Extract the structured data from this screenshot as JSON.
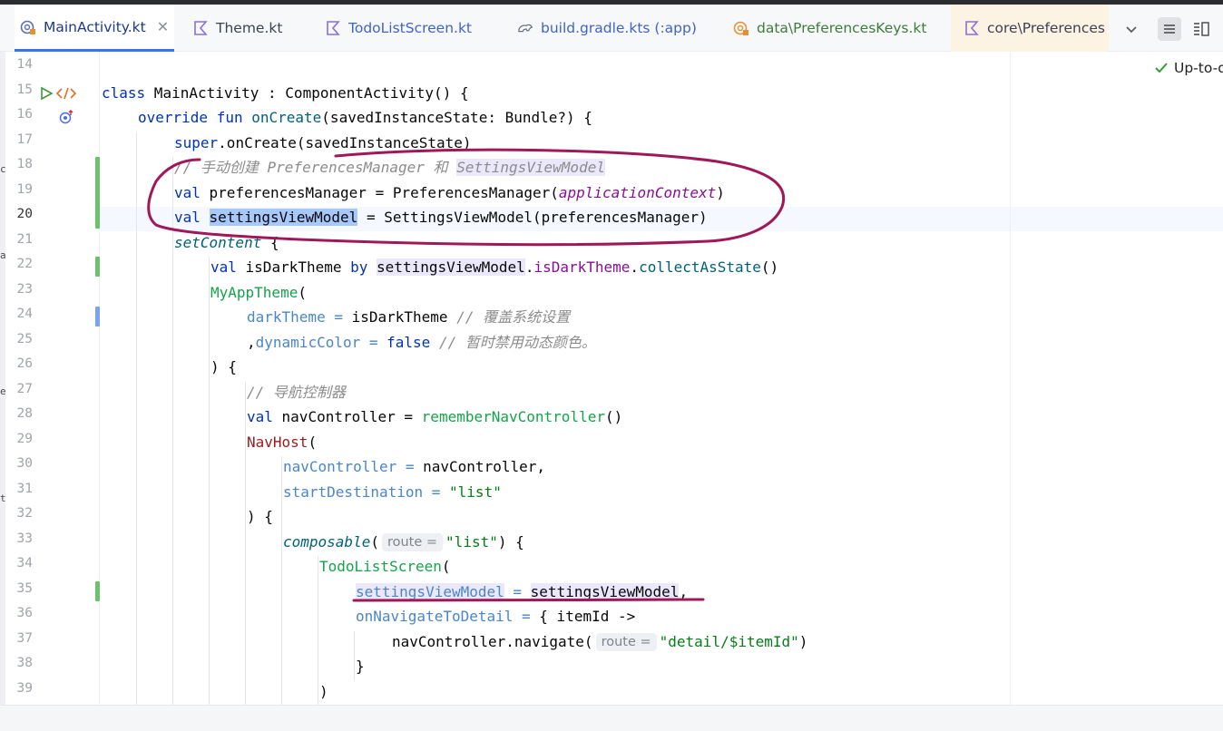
{
  "tabs": [
    {
      "label": "MainActivity.kt",
      "icon": "kotlin-class-icon",
      "active": true
    },
    {
      "label": "Theme.kt",
      "icon": "kotlin-file-icon"
    },
    {
      "label": "TodoListScreen.kt",
      "icon": "kotlin-file-icon"
    },
    {
      "label": "build.gradle.kts (:app)",
      "icon": "gradle-icon"
    },
    {
      "label": "data\\PreferencesKeys.kt",
      "icon": "kotlin-class-icon"
    },
    {
      "label": "core\\Preferences",
      "icon": "kotlin-file-icon"
    }
  ],
  "status": {
    "text": "Up-to-d"
  },
  "left_edge": {
    "c1": "c",
    "c2": "a",
    "c3": "e",
    "c4": "t"
  },
  "lines": {
    "n14": "14",
    "n15": "15",
    "n16": "16",
    "n17": "17",
    "n18": "18",
    "n19": "19",
    "n20": "20",
    "n21": "21",
    "n22": "22",
    "n23": "23",
    "n24": "24",
    "n25": "25",
    "n26": "26",
    "n27": "27",
    "n28": "28",
    "n29": "29",
    "n30": "30",
    "n31": "31",
    "n32": "32",
    "n33": "33",
    "n34": "34",
    "n35": "35",
    "n36": "36",
    "n37": "37",
    "n38": "38",
    "n39": "39"
  },
  "code": {
    "l15": {
      "kw": "class",
      "rest": " MainActivity : ComponentActivity() {"
    },
    "l16": {
      "kw": "override fun",
      "fn": "onCreate",
      "rest": "(savedInstanceState: Bundle?) {"
    },
    "l17": {
      "kw": "super",
      "rest": ".onCreate(savedInstanceState)"
    },
    "l18": {
      "comment": "// 手动创建 PreferencesManager 和 ",
      "comment_hl": "SettingsViewModel"
    },
    "l19": {
      "kw": "val",
      "mid": " preferencesManager = PreferencesManager(",
      "ctx": "applicationContext",
      "end": ")"
    },
    "l20": {
      "kw": "val",
      "sel": "settingsViewModel",
      "rest": " = SettingsViewModel(preferencesManager)"
    },
    "l21": {
      "fn": "setContent",
      "rest": " {"
    },
    "l22": {
      "kw": "val",
      "a": " isDarkTheme ",
      "by": "by",
      "b": " ",
      "vm": "settingsViewModel",
      "dot": ".",
      "prop": "isDarkTheme",
      "dot2": ".",
      "fn": "collectAsState",
      "end": "()"
    },
    "l23": {
      "comp": "MyAppTheme",
      "rest": "("
    },
    "l24": {
      "param": "darkTheme =",
      "val": " isDarkTheme ",
      "comment": "// 覆盖系统设置"
    },
    "l25": {
      "comma": ",",
      "param": "dynamicColor =",
      "sp": " ",
      "kw": "false",
      "sp2": " ",
      "comment": "// 暂时禁用动态颜色。"
    },
    "l26": {
      "rest": ") {"
    },
    "l27": {
      "comment": "// 导航控制器"
    },
    "l28": {
      "kw": "val",
      "mid": " navController = ",
      "fn": "rememberNavController",
      "end": "()"
    },
    "l29": {
      "navhost": "NavHost",
      "rest": "("
    },
    "l30": {
      "param": "navController =",
      "rest": " navController,"
    },
    "l31": {
      "param": "startDestination =",
      "sp": " ",
      "str": "\"list\""
    },
    "l32": {
      "rest": ") {"
    },
    "l33": {
      "fn": "composable",
      "open": "(",
      "hint": "route =",
      "str": "\"list\"",
      "end": ") {"
    },
    "l34": {
      "comp": "TodoListScreen",
      "rest": "("
    },
    "l35": {
      "param": "settingsViewModel",
      "eq": " = ",
      "val": "settingsViewModel",
      "end": ","
    },
    "l36": {
      "param": "onNavigateToDetail =",
      "rest": " { itemId ->"
    },
    "l37": {
      "mid": "navController.navigate(",
      "hint": "route =",
      "str": "\"detail/$itemId\"",
      "end": ")"
    },
    "l38": {
      "rest": "}"
    },
    "l39": {
      "rest": ")"
    }
  },
  "colors": {
    "keyword": "#0033b3",
    "function": "#00627a",
    "comment": "#8c8c8c",
    "string": "#067d17",
    "composable": "#16a34a",
    "annotation_ink": "#a0185a",
    "active_tab_underline": "#3574f0"
  }
}
